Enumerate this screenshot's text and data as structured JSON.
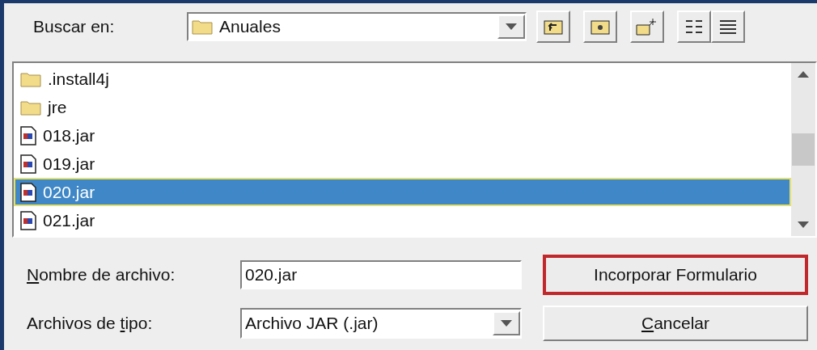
{
  "look_in": {
    "label": "Buscar en:",
    "value": "Anuales"
  },
  "files": [
    {
      "name": ".install4j",
      "kind": "folder",
      "selected": false
    },
    {
      "name": "jre",
      "kind": "folder",
      "selected": false
    },
    {
      "name": "018.jar",
      "kind": "jar",
      "selected": false
    },
    {
      "name": "019.jar",
      "kind": "jar",
      "selected": false
    },
    {
      "name": "020.jar",
      "kind": "jar",
      "selected": true
    },
    {
      "name": "021.jar",
      "kind": "jar",
      "selected": false
    }
  ],
  "file_name": {
    "label_key": "N",
    "label_after": "ombre de archivo:",
    "value": "020.jar"
  },
  "file_type": {
    "label_before": "Archivos de ",
    "label_key": "t",
    "label_after": "ipo:",
    "value": "Archivo JAR (.jar)"
  },
  "buttons": [
    {
      "label_before": "Incorporar Formulario",
      "highlighted": true
    },
    {
      "label_key": "C",
      "label_after": "ancelar",
      "highlighted": false
    }
  ]
}
